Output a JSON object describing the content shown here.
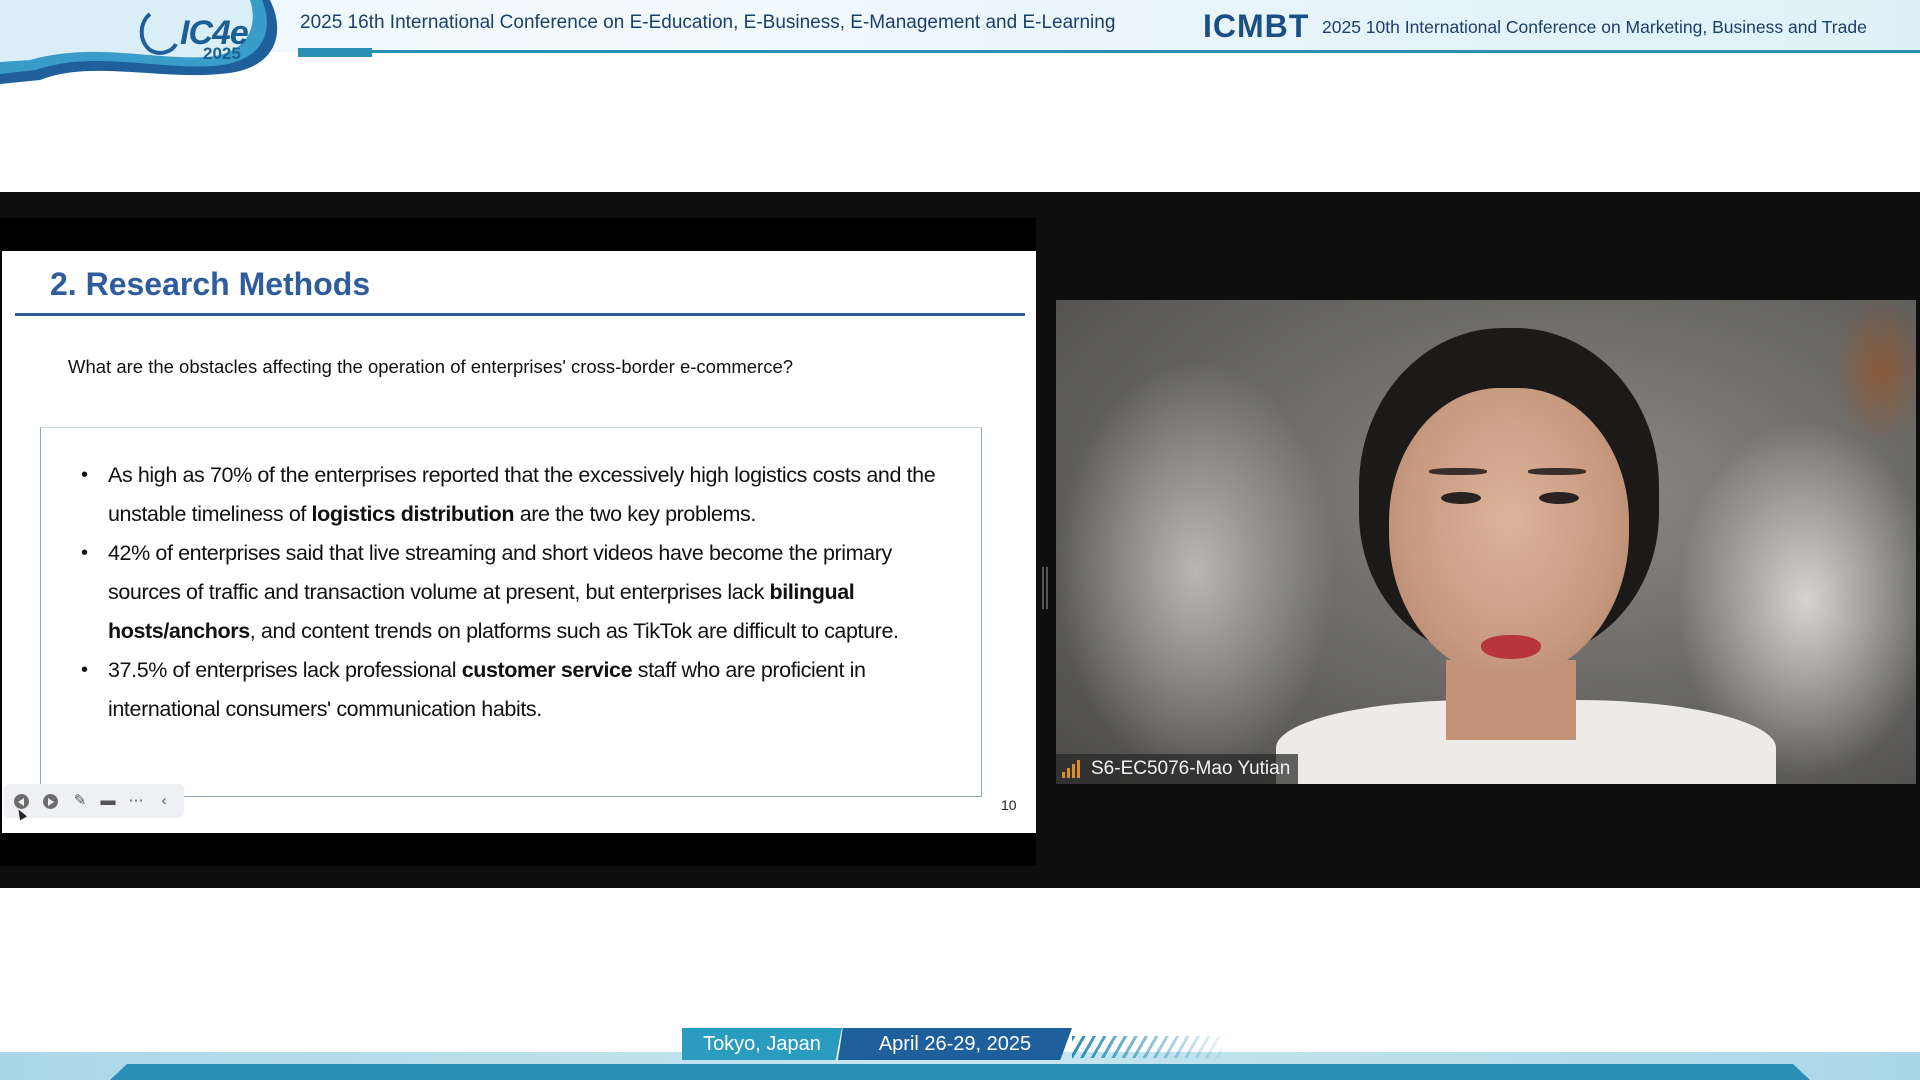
{
  "header": {
    "logo_text": "IC4e",
    "logo_year": "2025",
    "conference_1": "2025 16th International Conference on E-Education, E-Business, E-Management and E-Learning",
    "logo_2": "ICMBT",
    "conference_2": "2025 10th International Conference on Marketing, Business and Trade"
  },
  "slide": {
    "title": "2. Research Methods",
    "question": "What are the obstacles affecting the operation of enterprises' cross-border e-commerce?",
    "bullets": [
      {
        "before": "As high as 70% of the enterprises reported that the excessively high logistics costs and the unstable timeliness of ",
        "bold": "logistics distribution",
        "after": " are the two key problems."
      },
      {
        "before": "42% of enterprises said that live streaming and short videos have become the primary sources of traffic and transaction volume at present, but enterprises lack ",
        "bold": "bilingual hosts/anchors",
        "after": ", and content trends on platforms such as TikTok are difficult to capture."
      },
      {
        "before": "37.5% of enterprises lack professional ",
        "bold": "customer service",
        "after": " staff who are proficient in international consumers' communication habits."
      }
    ],
    "page_number": "10",
    "tools": [
      "prev-slide-icon",
      "next-slide-icon",
      "pen-icon",
      "screen-icon",
      "more-icon",
      "collapse-icon"
    ]
  },
  "video": {
    "participant_name": "S6-EC5076-Mao Yutian",
    "signal_color": "#e08a2e"
  },
  "footer": {
    "location": "Tokyo, Japan",
    "dates": "April 26-29, 2025"
  },
  "colors": {
    "accent_blue": "#2a8fb5",
    "title_blue": "#2f5c9a",
    "dark_blue": "#1e5f9c"
  }
}
